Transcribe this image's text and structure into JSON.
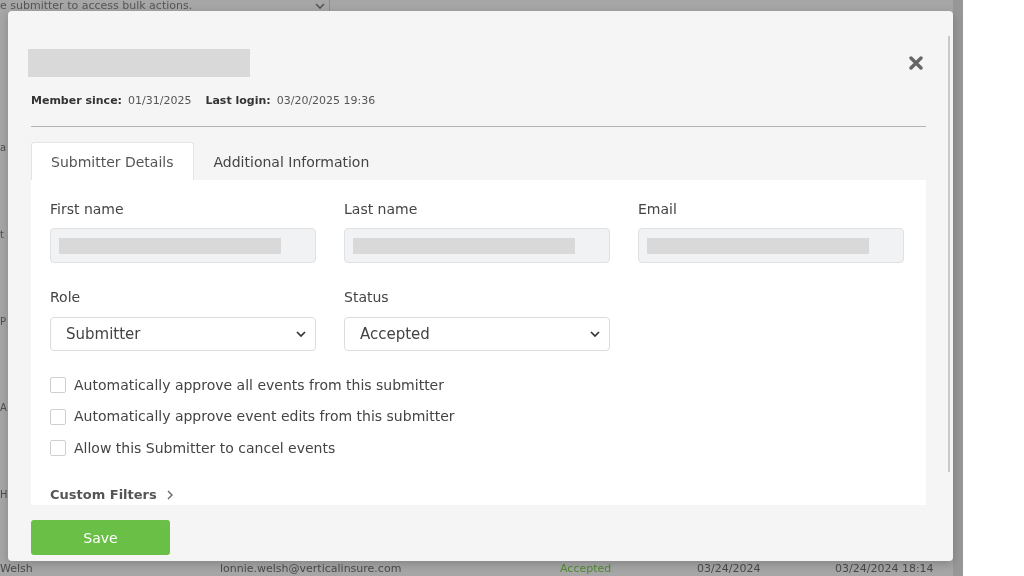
{
  "background_page": {
    "bulk_select": {
      "value": "e submitter to access bulk actions."
    },
    "row_fragments": [
      "a",
      "t",
      "P",
      "A",
      "H"
    ],
    "bottom_row": {
      "name": "Welsh",
      "email": "lonnie.welsh@verticalinsure.com",
      "status": "Accepted",
      "date": "03/24/2024",
      "last_login": "03/24/2024 18:14"
    }
  },
  "modal": {
    "title_redacted": true,
    "meta": [
      {
        "label": "Member since:",
        "value": "01/31/2025"
      },
      {
        "label": "Last login:",
        "value": "03/20/2025 19:36"
      }
    ],
    "tabs": [
      {
        "label": "Submitter Details",
        "selected": true
      },
      {
        "label": "Additional Information",
        "selected": false
      }
    ],
    "text_fields": [
      {
        "label": "First name",
        "redacted": true,
        "disabled": true
      },
      {
        "label": "Last name",
        "redacted": true,
        "disabled": true
      },
      {
        "label": "Email",
        "redacted": true,
        "disabled": true
      }
    ],
    "selects": [
      {
        "label": "Role",
        "value": "Submitter"
      },
      {
        "label": "Status",
        "value": "Accepted"
      }
    ],
    "checkboxes": [
      {
        "label": "Automatically approve all events from this submitter",
        "checked": false
      },
      {
        "label": "Automatically approve event edits from this submitter",
        "checked": false
      },
      {
        "label": "Allow this Submitter to cancel events",
        "checked": false
      }
    ],
    "custom_filters": {
      "label": "Custom Filters",
      "expanded": false
    },
    "save_button": "Save"
  }
}
